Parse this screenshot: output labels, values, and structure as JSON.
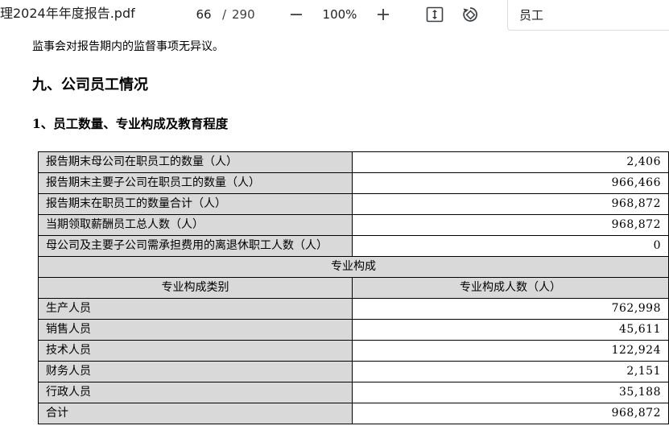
{
  "toolbar": {
    "title": "理2024年年度报告.pdf",
    "page_current": "66",
    "page_separator": "/",
    "page_total": "290",
    "zoom": "100%",
    "search_value": "员工"
  },
  "document": {
    "statement": "监事会对报告期内的监督事项无异议。",
    "section_heading": "九、公司员工情况",
    "sub_heading": "1、员工数量、专业构成及教育程度",
    "table": {
      "summary_rows": [
        {
          "label": "报告期末母公司在职员工的数量（人）",
          "value": "2,406"
        },
        {
          "label": "报告期末主要子公司在职员工的数量（人）",
          "value": "966,466"
        },
        {
          "label": "报告期末在职员工的数量合计（人）",
          "value": "968,872"
        },
        {
          "label": "当期领取薪酬员工总人数（人）",
          "value": "968,872"
        },
        {
          "label": "母公司及主要子公司需承担费用的离退休职工人数（人）",
          "value": "0"
        }
      ],
      "band_title": "专业构成",
      "headers": [
        "专业构成类别",
        "专业构成人数（人）"
      ],
      "composition_rows": [
        {
          "label": "生产人员",
          "value": "762,998"
        },
        {
          "label": "销售人员",
          "value": "45,611"
        },
        {
          "label": "技术人员",
          "value": "122,924"
        },
        {
          "label": "财务人员",
          "value": "2,151"
        },
        {
          "label": "行政人员",
          "value": "35,188"
        },
        {
          "label": "合计",
          "value": "968,872"
        }
      ]
    }
  }
}
